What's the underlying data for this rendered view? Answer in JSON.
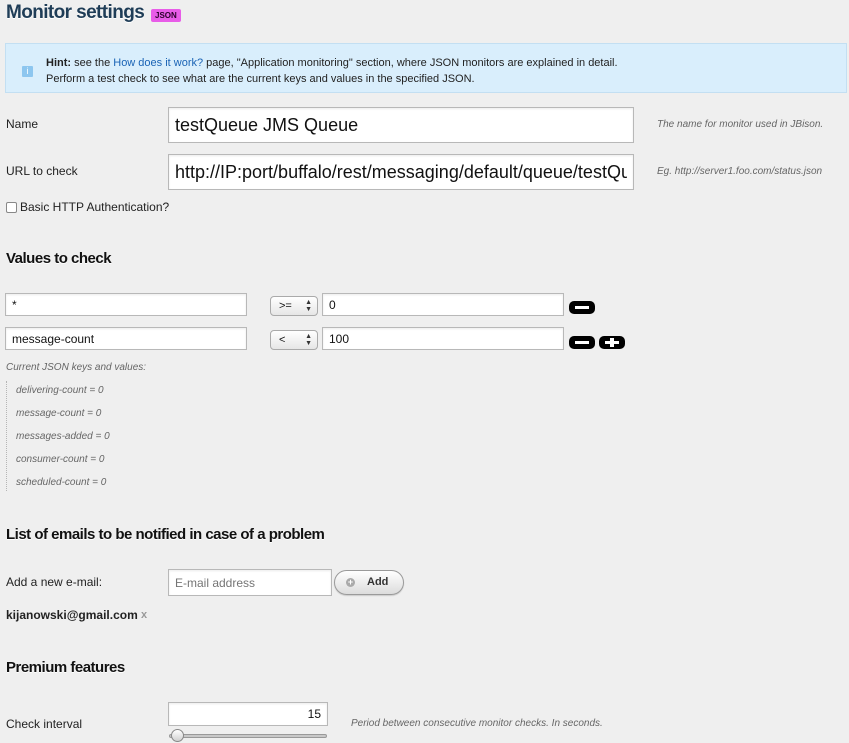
{
  "header": {
    "title": "Monitor settings",
    "badge": "JSON"
  },
  "hint": {
    "bold": "Hint:",
    "pre": " see the ",
    "link": "How does it work?",
    "post": " page, \"Application monitoring\" section, where JSON monitors are explained in detail.",
    "line2": "Perform a test check to see what are the current keys and values in the specified JSON."
  },
  "name": {
    "label": "Name",
    "value": "testQueue JMS Queue",
    "help": "The name for monitor used in JBison."
  },
  "url": {
    "label": "URL to check",
    "value": "http://IP:port/buffalo/rest/messaging/default/queue/testQu",
    "help": "Eg. http://server1.foo.com/status.json"
  },
  "basic_auth": {
    "label": "Basic HTTP Authentication?",
    "checked": false
  },
  "values_section": {
    "title": "Values to check",
    "rows": [
      {
        "key": "*",
        "op": ">=",
        "value": "0"
      },
      {
        "key": "message-count",
        "op": "<",
        "value": "100"
      }
    ],
    "keys_label": "Current JSON keys and values:",
    "keys": [
      "delivering-count = 0",
      "message-count = 0",
      "messages-added = 0",
      "consumer-count = 0",
      "scheduled-count = 0"
    ]
  },
  "emails_section": {
    "title": "List of emails to be notified in case of a problem",
    "add_label": "Add a new e-mail:",
    "placeholder": "E-mail address",
    "add_button": "Add",
    "emails": [
      "kijanowski@gmail.com"
    ],
    "remove": "x"
  },
  "premium": {
    "title": "Premium features",
    "interval_label": "Check interval",
    "interval_value": "15",
    "interval_help": "Period between consecutive monitor checks. In seconds."
  }
}
